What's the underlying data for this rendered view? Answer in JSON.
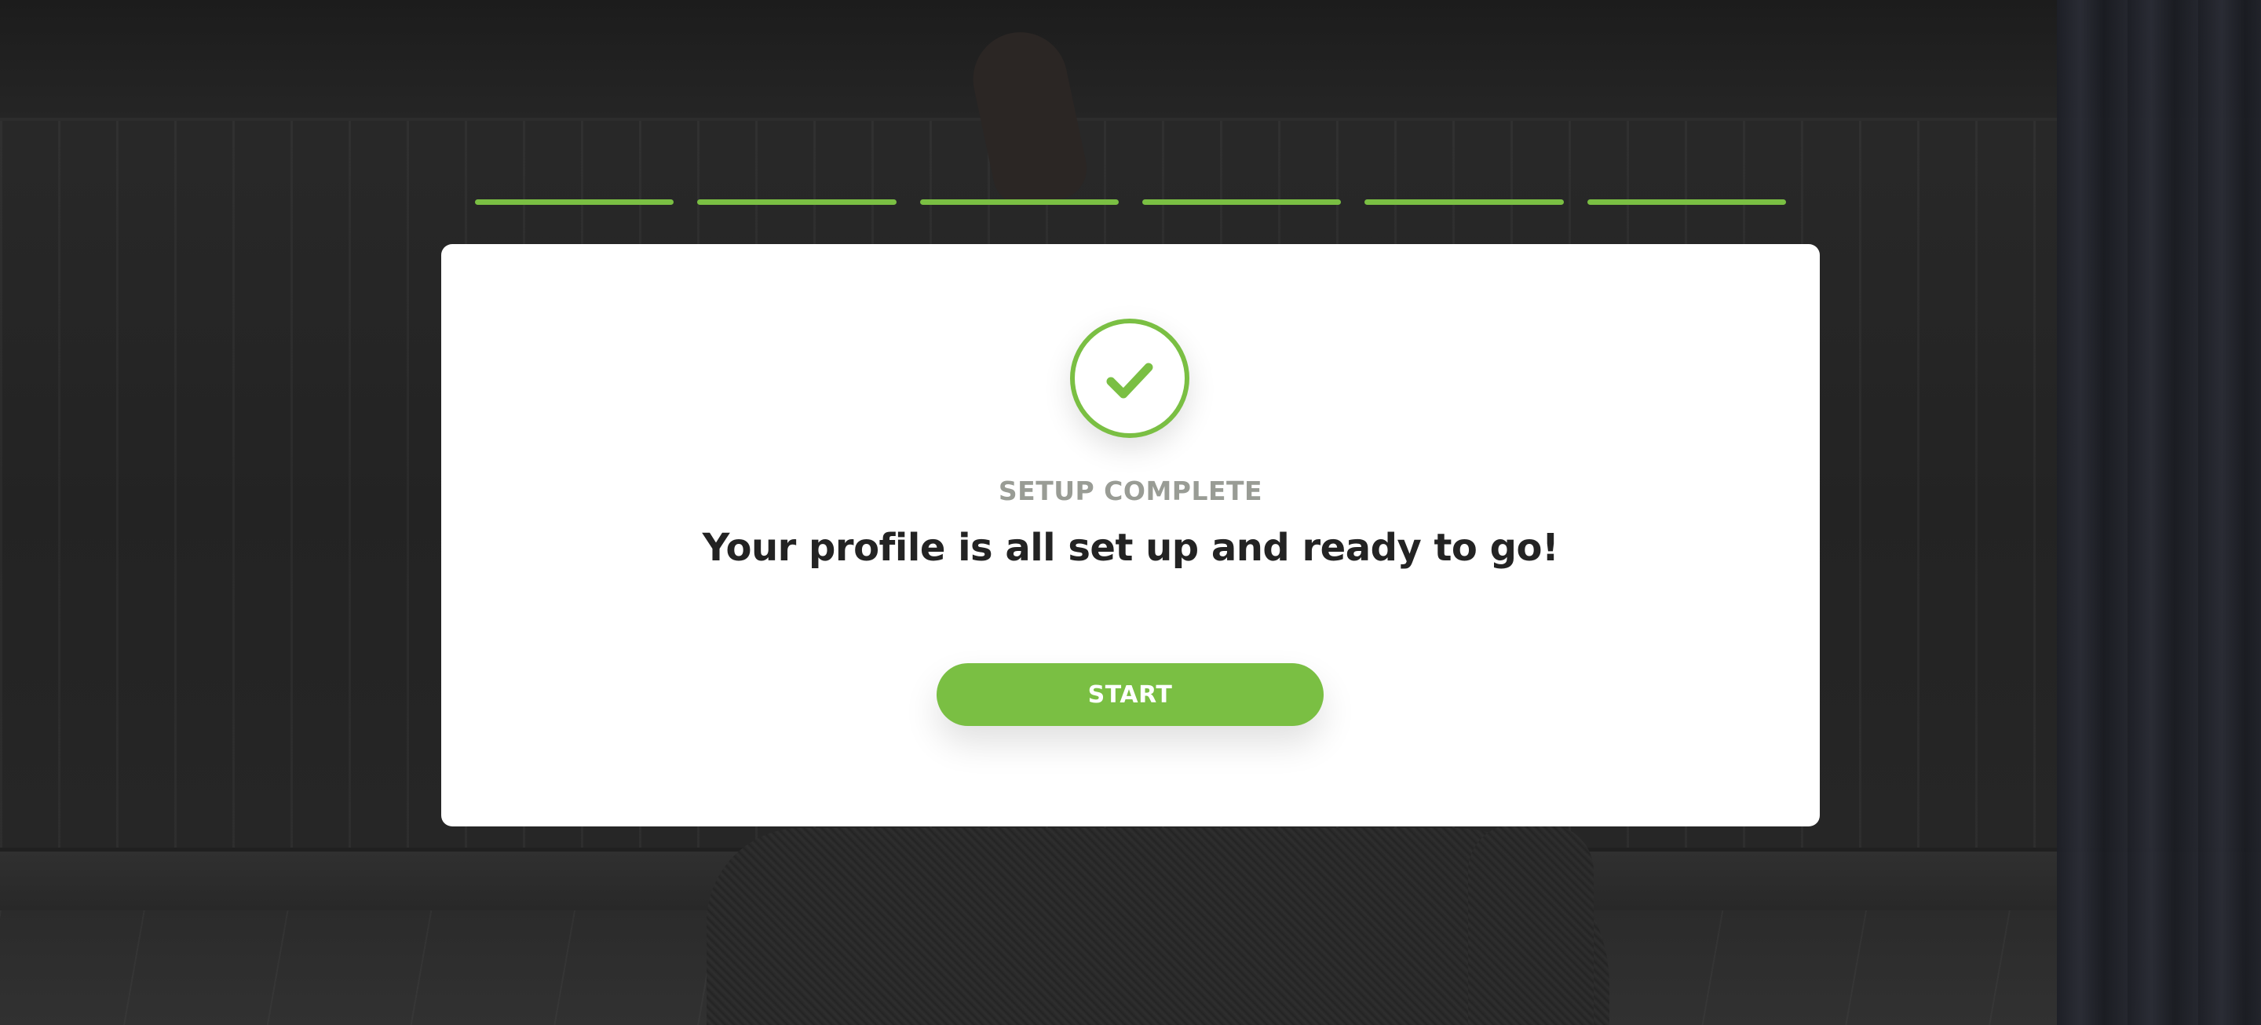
{
  "progress": {
    "steps_total": 6,
    "steps_complete": 6,
    "color": "#7abf43"
  },
  "card": {
    "icon": "checkmark-circle-icon",
    "eyebrow": "SETUP COMPLETE",
    "headline": "Your profile is all set up and ready to go!",
    "start_label": "START"
  },
  "colors": {
    "accent": "#7abf43",
    "eyebrow_text": "#999c95",
    "headline_text": "#232323",
    "card_bg": "#ffffff",
    "overlay_bg": "#202020"
  }
}
